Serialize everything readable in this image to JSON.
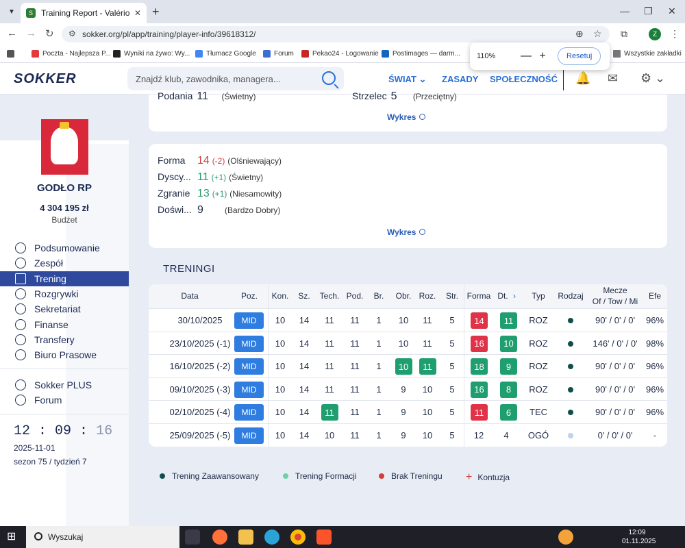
{
  "browser": {
    "tab_title": "Training Report - Valério Oliveir",
    "url": "sokker.org/pl/app/training/player-info/39618312/",
    "bookmarks": [
      "Poczta - Najlepsza P...",
      "Wyniki na żywo: Wy...",
      "Tłumacz Google",
      "Forum",
      "Pekao24 - Logowanie",
      "Postimages — darm...",
      "Wszystkie zakładki"
    ],
    "zoom": {
      "value": "110%",
      "minus": "—",
      "plus": "+",
      "reset": "Resetuj"
    },
    "profile_initial": "Z"
  },
  "site": {
    "logo": "SOKKER",
    "search_placeholder": "Znajdź klub, zawodnika, managera...",
    "menu": [
      "ŚWIAT",
      "ZASADY",
      "SPOŁECZNOŚĆ"
    ]
  },
  "sidebar": {
    "club_name": "GODŁO RP",
    "budget": "4 304 195 zł",
    "budget_label": "Budżet",
    "items": [
      {
        "label": "Podsumowanie",
        "active": false
      },
      {
        "label": "Zespół",
        "active": false
      },
      {
        "label": "Trening",
        "active": true
      },
      {
        "label": "Rozgrywki",
        "active": false
      },
      {
        "label": "Sekretariat",
        "active": false
      },
      {
        "label": "Finanse",
        "active": false
      },
      {
        "label": "Transfery",
        "active": false
      },
      {
        "label": "Biuro Prasowe",
        "active": false
      }
    ],
    "extra_items": [
      "Sokker PLUS",
      "Forum"
    ],
    "time_h": "12",
    "time_m": "09",
    "time_s": "16",
    "date": "2025-11-01",
    "season": "sezon 75 / tydzień 7"
  },
  "skills_top": {
    "left_label": "Podania",
    "left_value": "11",
    "left_desc": "(Świetny)",
    "right_label": "Strzelec",
    "right_value": "5",
    "right_desc": "(Przeciętny)",
    "chart_link": "Wykres"
  },
  "attributes": {
    "rows": [
      {
        "label": "Forma",
        "value": "14",
        "delta": "(-2)",
        "delta_type": "neg",
        "desc": "(Olśniewający)"
      },
      {
        "label": "Dyscy...",
        "value": "11",
        "delta": "(+1)",
        "delta_type": "pos",
        "desc": "(Świetny)"
      },
      {
        "label": "Zgranie",
        "value": "13",
        "delta": "(+1)",
        "delta_type": "pos",
        "desc": "(Niesamowity)"
      },
      {
        "label": "Doświ...",
        "value": "9",
        "delta": "",
        "delta_type": "none",
        "desc": "(Bardzo Dobry)"
      }
    ],
    "chart_link": "Wykres"
  },
  "trainings": {
    "title": "TRENINGI",
    "headers": [
      "Data",
      "Poz.",
      "Kon.",
      "Sz.",
      "Tech.",
      "Pod.",
      "Br.",
      "Obr.",
      "Roz.",
      "Str.",
      "Forma",
      "Dt.",
      "Typ",
      "Rodzaj",
      "Mecze",
      "Of / Tow / Mi",
      "Efe"
    ],
    "rows": [
      {
        "date": "30/10/2025",
        "pos": "MID",
        "kon": "10",
        "sz": "14",
        "tech": "11",
        "pod": "11",
        "br": "1",
        "obr": "10",
        "roz": "11",
        "str": "5",
        "forma": "14",
        "dt": "11",
        "typ": "ROZ",
        "kind": "adv",
        "mecze": "90' / 0' / 0'",
        "efe": "96%"
      },
      {
        "date": "23/10/2025 (-1)",
        "pos": "MID",
        "kon": "10",
        "sz": "14",
        "tech": "11",
        "pod": "11",
        "br": "1",
        "obr": "10",
        "roz": "11",
        "str": "5",
        "forma": "16",
        "dt": "10",
        "typ": "ROZ",
        "kind": "adv",
        "mecze": "146' / 0' / 0'",
        "efe": "98%"
      },
      {
        "date": "16/10/2025 (-2)",
        "pos": "MID",
        "kon": "10",
        "sz": "14",
        "tech": "11",
        "pod": "11",
        "br": "1",
        "obr": "10",
        "roz": "11",
        "str": "5",
        "forma": "18",
        "dt": "9",
        "typ": "ROZ",
        "kind": "adv",
        "mecze": "90' / 0' / 0'",
        "efe": "96%"
      },
      {
        "date": "09/10/2025 (-3)",
        "pos": "MID",
        "kon": "10",
        "sz": "14",
        "tech": "11",
        "pod": "11",
        "br": "1",
        "obr": "9",
        "roz": "10",
        "str": "5",
        "forma": "16",
        "dt": "8",
        "typ": "ROZ",
        "kind": "adv",
        "mecze": "90' / 0' / 0'",
        "efe": "96%"
      },
      {
        "date": "02/10/2025 (-4)",
        "pos": "MID",
        "kon": "10",
        "sz": "14",
        "tech": "11",
        "pod": "11",
        "br": "1",
        "obr": "9",
        "roz": "10",
        "str": "5",
        "forma": "11",
        "dt": "6",
        "typ": "TEC",
        "kind": "adv",
        "mecze": "90' / 0' / 0'",
        "efe": "96%"
      },
      {
        "date": "25/09/2025 (-5)",
        "pos": "MID",
        "kon": "10",
        "sz": "14",
        "tech": "10",
        "pod": "11",
        "br": "1",
        "obr": "9",
        "roz": "10",
        "str": "5",
        "forma": "12",
        "dt": "4",
        "typ": "OGÓ",
        "kind": "none",
        "mecze": "0' / 0' / 0'",
        "efe": "-"
      }
    ],
    "legend": [
      "Trening Zaawansowany",
      "Trening Formacji",
      "Brak Treningu",
      "Kontuzja"
    ]
  },
  "colors": {
    "green": "#1f9e70",
    "red": "#e03348",
    "blue": "#2f7de0",
    "dark": "#1b2a52"
  },
  "taskbar": {
    "search": "Wyszukaj",
    "time": "12:09",
    "date": "01.11.2025"
  }
}
